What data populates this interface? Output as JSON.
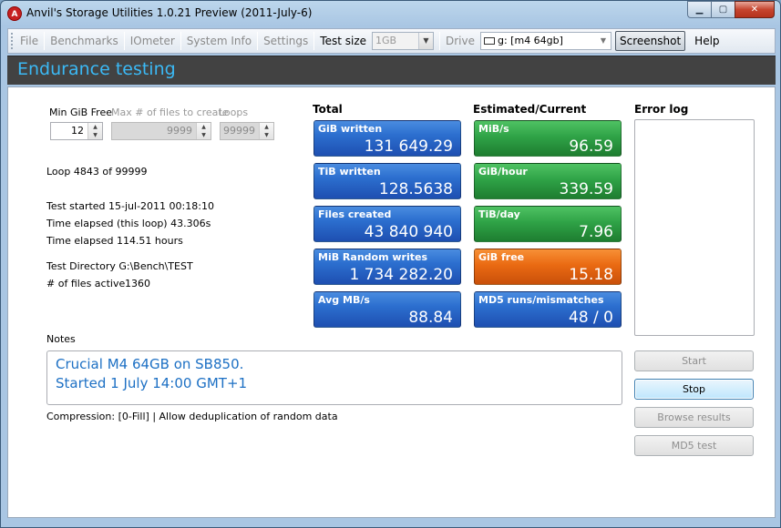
{
  "window": {
    "title": "Anvil's Storage Utilities 1.0.21 Preview (2011-July-6)"
  },
  "menu": {
    "file": "File",
    "benchmarks": "Benchmarks",
    "iometer": "IOmeter",
    "system_info": "System Info",
    "settings": "Settings",
    "test_size_label": "Test size",
    "test_size_value": "1GB",
    "drive_label": "Drive",
    "drive_value": "g: [m4 64gb]",
    "screenshot": "Screenshot",
    "help": "Help"
  },
  "header": {
    "title": "Endurance testing"
  },
  "params": {
    "min_free_label": "Min GiB Free",
    "min_free_value": "12",
    "max_files_label": "Max # of files to create",
    "max_files_value": "9999",
    "loops_label": "Loops",
    "loops_value": "99999"
  },
  "info": {
    "loop": "Loop 4843 of 99999",
    "test_started": "Test started 15-jul-2011 00:18:10",
    "elapsed_loop": "Time elapsed (this loop) 43.306s",
    "elapsed_total": "Time elapsed 114.51 hours",
    "test_dir": "Test Directory G:\\Bench\\TEST",
    "files_active_label": "# of files active",
    "files_active_value": "1360"
  },
  "total": {
    "heading": "Total",
    "tiles": [
      {
        "label": "GiB written",
        "value": "131 649.29"
      },
      {
        "label": "TiB written",
        "value": "128.5638"
      },
      {
        "label": "Files created",
        "value": "43 840 940"
      },
      {
        "label": "MiB Random writes",
        "value": "1 734 282.20"
      },
      {
        "label": "Avg MB/s",
        "value": "88.84"
      }
    ]
  },
  "estimated": {
    "heading": "Estimated/Current",
    "tiles": [
      {
        "label": "MiB/s",
        "value": "96.59"
      },
      {
        "label": "GiB/hour",
        "value": "339.59"
      },
      {
        "label": "TiB/day",
        "value": "7.96"
      },
      {
        "label": "GiB free",
        "value": "15.18"
      },
      {
        "label": "MD5 runs/mismatches",
        "value": "48 / 0"
      }
    ]
  },
  "error_log": {
    "heading": "Error log"
  },
  "notes": {
    "label": "Notes",
    "line1": "Crucial M4 64GB on SB850.",
    "line2": "Started 1 July 14:00 GMT+1"
  },
  "compression": "Compression: [0-Fill] | Allow deduplication of random data",
  "actions": {
    "start": "Start",
    "stop": "Stop",
    "browse": "Browse results",
    "md5": "MD5 test"
  },
  "colors": {
    "header_text": "#3bb9f5",
    "tile_blue": "#2c6fcf",
    "tile_green": "#2fa347",
    "tile_orange": "#ea6a12",
    "notes_text": "#1d70c4"
  }
}
